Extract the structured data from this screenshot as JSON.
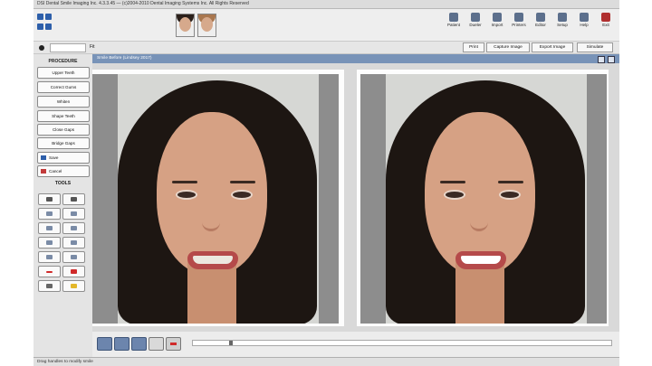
{
  "window": {
    "title": "DSI Dental Smile Imaging Inc. 4.3.3.45 — (c)2004-2010 Dental Imaging Systems Inc. All Rights Reserved"
  },
  "toolbar": {
    "items": [
      "Patient",
      "Dueler",
      "Import",
      "Printers",
      "Editor",
      "Setup",
      "Help",
      "Exit"
    ]
  },
  "row2": {
    "zoom": "Fit",
    "buttons": [
      "Print",
      "Capture Image",
      "Export Image",
      "Simulate"
    ]
  },
  "panel": {
    "header": "PROCEDURE",
    "buttons": [
      "Upper Teeth",
      "Correct Gums",
      "Whiten",
      "Shape Teeth",
      "Close Gaps",
      "Bridge Gaps"
    ],
    "save_label": "Save",
    "cancel_label": "Cancel",
    "tools_header": "TOOLS"
  },
  "workspace": {
    "title": "Smile Before (Lindsey 2017)"
  },
  "status": {
    "text": "Drag handles to modify smile"
  },
  "colors": {
    "header_bar": "#7893b8",
    "accent_blue": "#2d5faa",
    "play_buttons": "#6c85ad"
  },
  "icons": {
    "quick": [
      "open-icon",
      "save-icon",
      "print-icon",
      "undo-icon"
    ],
    "tools": [
      "brush-icon",
      "pencil-icon",
      "eraser-icon",
      "clone-icon",
      "lasso-icon",
      "marquee-icon",
      "magnify-icon",
      "hand-icon",
      "arrow-left-icon",
      "arrow-right-icon",
      "red-dash-icon",
      "plus-icon",
      "lock-icon",
      "star-icon"
    ]
  }
}
